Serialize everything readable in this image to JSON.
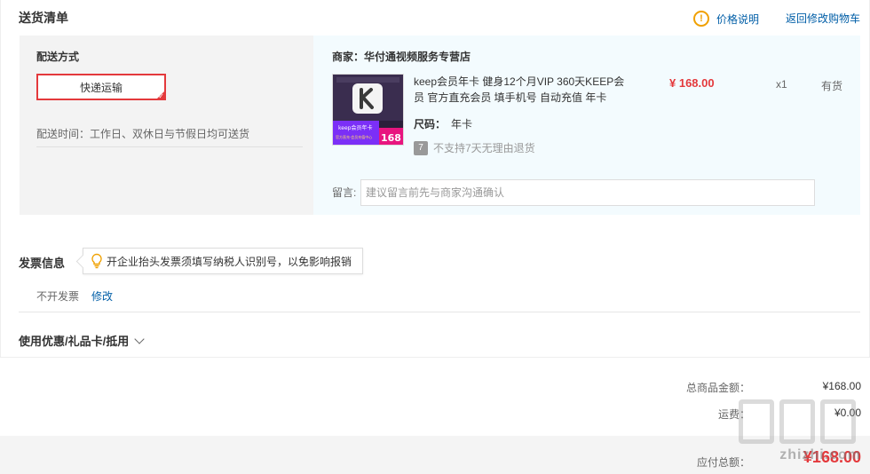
{
  "header": {
    "title": "送货清单",
    "price_note": "价格说明",
    "back_link": "返回修改购物车"
  },
  "delivery": {
    "title": "配送方式",
    "method": "快递运输",
    "time": "配送时间：工作日、双休日与节假日均可送货"
  },
  "shop": {
    "merchant": "商家：华付通视频服务专营店",
    "product": {
      "name": "keep会员年卡 健身12个月VIP 360天KEEP会员 官方直充会员 填手机号 自动充值 年卡",
      "size_label": "尺码：",
      "size_value": "年卡",
      "return_icon": "7",
      "return_text": "不支持7天无理由退货",
      "price": "¥ 168.00",
      "qty": "x1",
      "stock": "有货",
      "thumb_badge_top": "keep会员年卡",
      "thumb_badge_sub": "官方直充·会员充值中心",
      "thumb_price": "168"
    },
    "message_label": "留言:",
    "message_placeholder": "建议留言前先与商家沟通确认"
  },
  "invoice": {
    "title": "发票信息",
    "tip": "开企业抬头发票须填写纳税人识别号，以免影响报销",
    "value": "不开发票",
    "edit": "修改"
  },
  "coupon": {
    "label": "使用优惠/礼品卡/抵用"
  },
  "totals": {
    "goods_label": "总商品金额：",
    "goods_value": "¥168.00",
    "shipping_label": "运费：",
    "shipping_value": "¥0.00",
    "pay_label": "应付总额：",
    "pay_value": "¥168.00"
  },
  "watermark": "zhizhi.com",
  "colors": {
    "accent_red": "#e4393c",
    "link_blue": "#005ea7",
    "warn_orange": "#f0a000"
  }
}
